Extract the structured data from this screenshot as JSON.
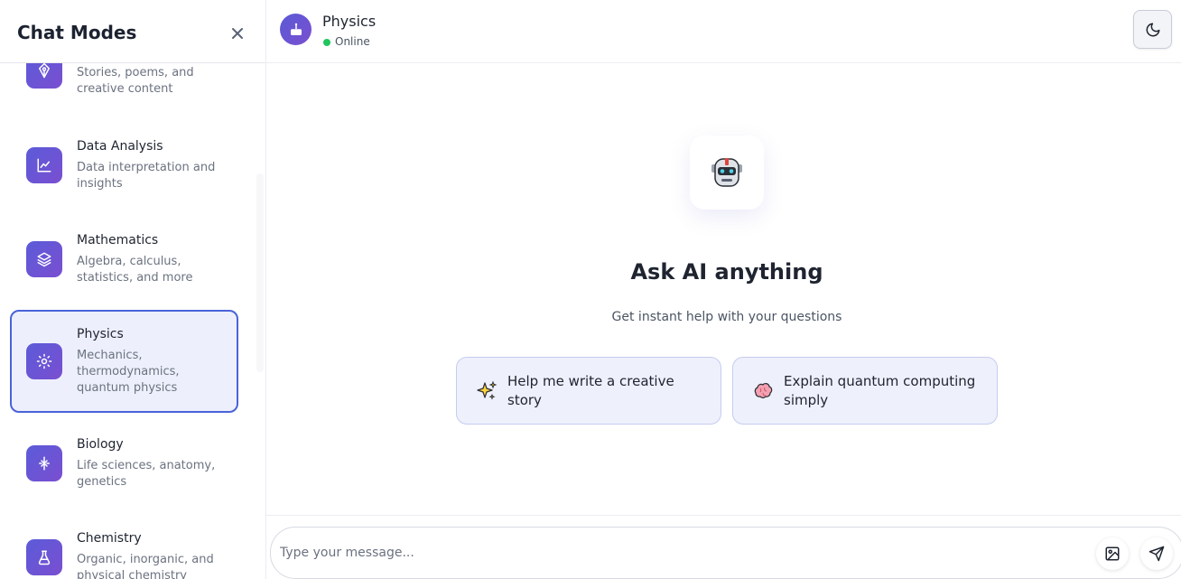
{
  "sidebar": {
    "title": "Chat Modes",
    "modes": [
      {
        "name": "",
        "description": "Stories, poems, and creative content",
        "icon": "pen-nib-icon"
      },
      {
        "name": "Data Analysis",
        "description": "Data interpretation and insights",
        "icon": "chart-line-icon"
      },
      {
        "name": "Mathematics",
        "description": "Algebra, calculus, statistics, and more",
        "icon": "layers-icon"
      },
      {
        "name": "Physics",
        "description": "Mechanics, thermodynamics, quantum physics",
        "icon": "atom-icon",
        "active": true
      },
      {
        "name": "Biology",
        "description": "Life sciences, anatomy, genetics",
        "icon": "dna-icon"
      },
      {
        "name": "Chemistry",
        "description": "Organic, inorganic, and physical chemistry",
        "icon": "flask-icon"
      }
    ]
  },
  "header": {
    "title": "Physics",
    "status": "Online",
    "status_color": "#22c55e",
    "theme_icon": "moon-icon"
  },
  "welcome": {
    "title": "Ask AI anything",
    "subtitle": "Get instant help with your questions",
    "avatar_icon": "robot-icon",
    "suggestions": [
      {
        "label": "Help me write a creative story",
        "icon": "sparkles-icon"
      },
      {
        "label": "Explain quantum computing simply",
        "icon": "brain-icon"
      }
    ]
  },
  "composer": {
    "placeholder": "Type your message...",
    "attach_icon": "image-icon",
    "send_icon": "send-icon"
  },
  "colors": {
    "accent": "#4a63d9",
    "icon_gradient_start": "#5b5bd9",
    "icon_gradient_end": "#7a4fd0",
    "active_bg": "#edf0fc"
  }
}
